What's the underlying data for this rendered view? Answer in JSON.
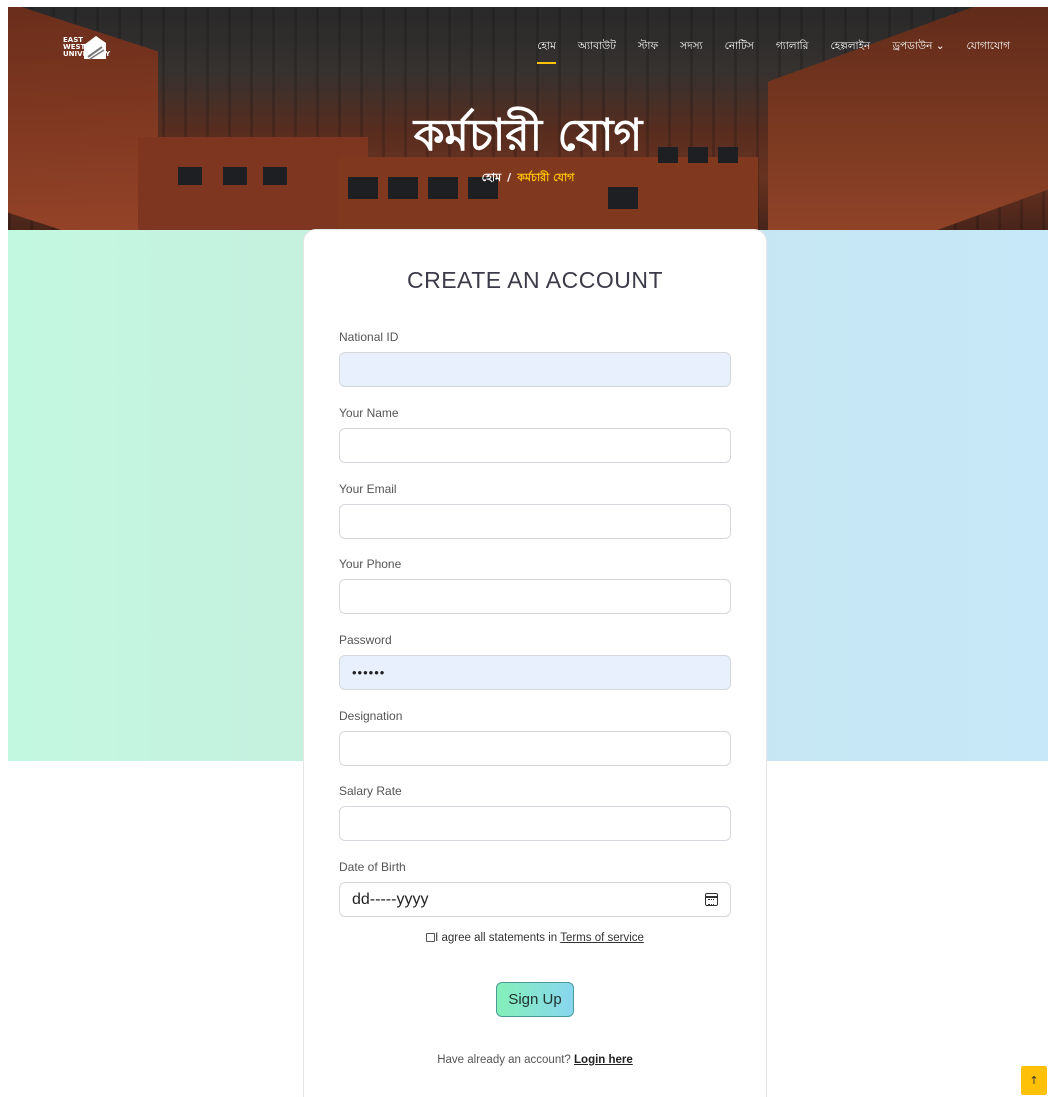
{
  "header": {
    "logo_text": "EAST WEST UNIVERSITY",
    "nav": [
      {
        "label": "হোম",
        "active": true
      },
      {
        "label": "অ্যাবাউট"
      },
      {
        "label": "স্টাফ"
      },
      {
        "label": "সদস্য"
      },
      {
        "label": "নোটিস"
      },
      {
        "label": "গ্যালারি"
      },
      {
        "label": "হেল্পলাইন"
      },
      {
        "label": "ড্রপডাউন ⌄"
      },
      {
        "label": "যোগাযোগ"
      }
    ],
    "title": "কর্মচারী যোগ",
    "breadcrumb": {
      "home": "হোম",
      "separator": "/",
      "current": "কর্মচারী যোগ"
    }
  },
  "form": {
    "heading": "CREATE AN ACCOUNT",
    "fields": [
      {
        "label": "National ID",
        "value": ""
      },
      {
        "label": "Your Name",
        "value": ""
      },
      {
        "label": "Your Email",
        "value": ""
      },
      {
        "label": "Your Phone",
        "value": ""
      },
      {
        "label": "Password",
        "value": "••••••"
      },
      {
        "label": "Designation",
        "value": ""
      },
      {
        "label": "Salary Rate",
        "value": ""
      },
      {
        "label": "Date of Birth",
        "value": "dd-----yyyy"
      }
    ],
    "agree_text": "I agree all statements in ",
    "terms_link": "Terms of service",
    "submit_label": "Sign Up",
    "login_prompt": "Have already an account? ",
    "login_link": "Login here"
  },
  "scroll_top_icon": "arrow-up-icon",
  "scroll_top_glyph": "↑",
  "colors": {
    "accent": "#ffc107"
  }
}
